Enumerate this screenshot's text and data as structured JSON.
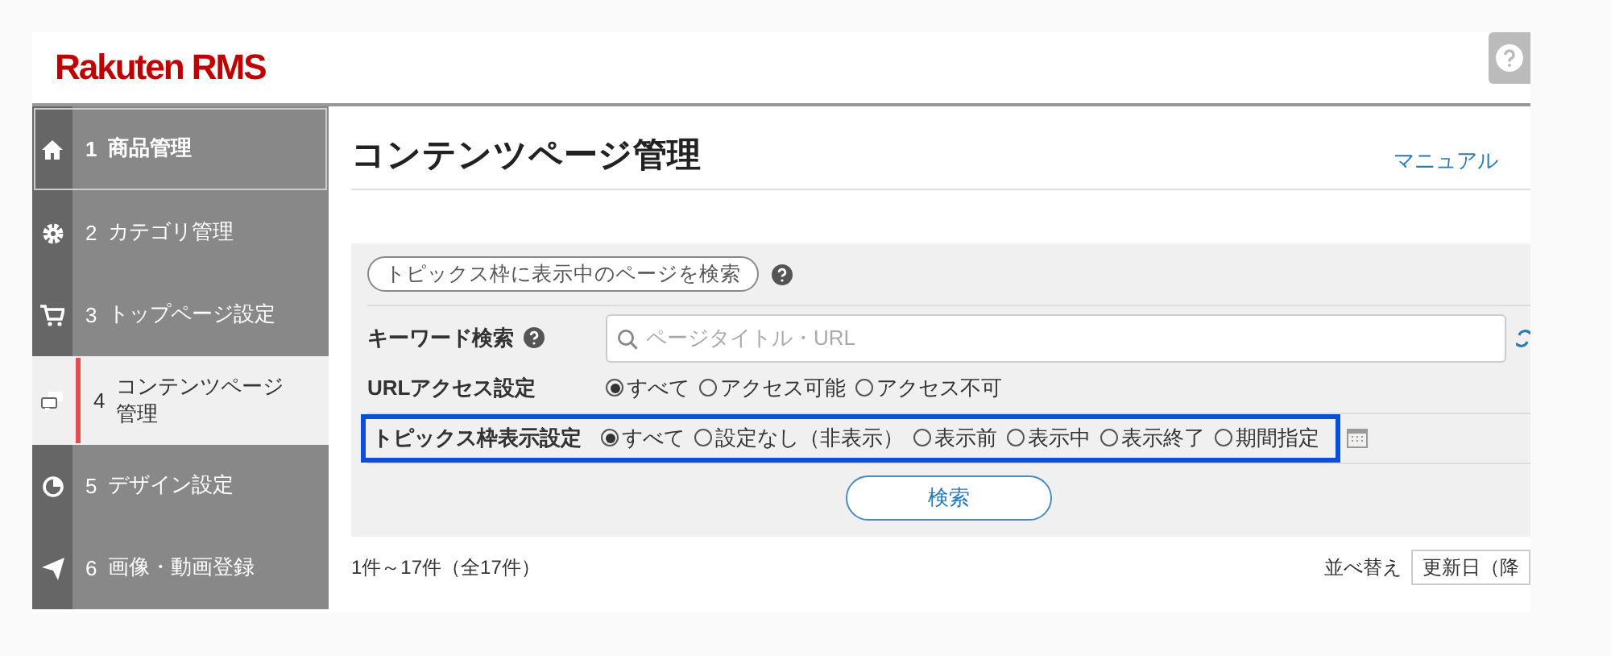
{
  "header": {
    "logo": "Rakuten RMS"
  },
  "sidebar": {
    "items": [
      {
        "number": "1",
        "label": "商品管理",
        "selected": false,
        "highlighted": true
      },
      {
        "number": "2",
        "label": "カテゴリ管理",
        "selected": false,
        "highlighted": false
      },
      {
        "number": "3",
        "label": "トップページ設定",
        "selected": false,
        "highlighted": false
      },
      {
        "number": "4",
        "label": "コンテンツページ管理",
        "selected": true,
        "highlighted": false
      },
      {
        "number": "5",
        "label": "デザイン設定",
        "selected": false,
        "highlighted": false
      },
      {
        "number": "6",
        "label": "画像・動画登録",
        "selected": false,
        "highlighted": false
      }
    ]
  },
  "page": {
    "title": "コンテンツページ管理",
    "manual_link": "マニュアル"
  },
  "search_panel": {
    "topics_button": "トピックス枠に表示中のページを検索",
    "keyword": {
      "label": "キーワード検索",
      "placeholder": "ページタイトル・URL"
    },
    "url_access": {
      "label": "URLアクセス設定",
      "options": [
        {
          "label": "すべて",
          "selected": true
        },
        {
          "label": "アクセス可能",
          "selected": false
        },
        {
          "label": "アクセス不可",
          "selected": false
        }
      ]
    },
    "topics_display": {
      "label": "トピックス枠表示設定",
      "highlighted": true,
      "options": [
        {
          "label": "すべて",
          "selected": true
        },
        {
          "label": "設定なし（非表示）",
          "selected": false
        },
        {
          "label": "表示前",
          "selected": false
        },
        {
          "label": "表示中",
          "selected": false
        },
        {
          "label": "表示終了",
          "selected": false
        },
        {
          "label": "期間指定",
          "selected": false
        }
      ]
    },
    "search_button": "検索"
  },
  "results": {
    "count": "1件～17件（全17件）",
    "sort_label": "並べ替え",
    "sort_value": "更新日（降"
  }
}
